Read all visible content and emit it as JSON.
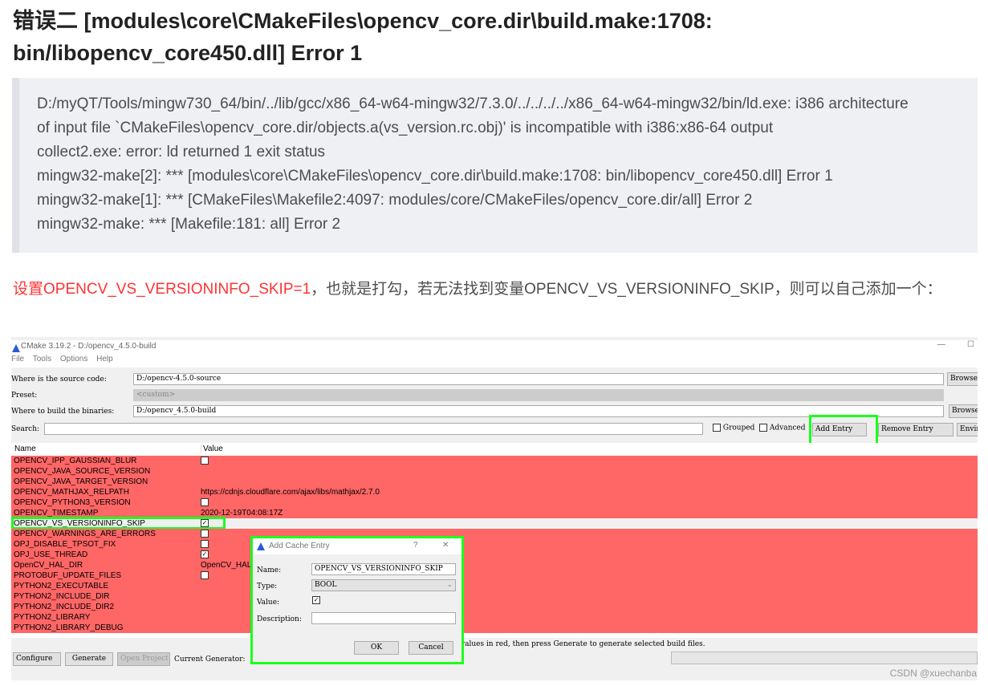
{
  "heading": "错误二 [modules\\core\\CMakeFiles\\opencv_core.dir\\build.make:1708: bin/libopencv_core450.dll] Error 1",
  "quote_lines": [
    "D:/myQT/Tools/mingw730_64/bin/../lib/gcc/x86_64-w64-mingw32/7.3.0/../../../../x86_64-w64-mingw32/bin/ld.exe: i386 architecture",
    "of input file `CMakeFiles\\opencv_core.dir/objects.a(vs_version.rc.obj)' is incompatible with i386:x86-64 output",
    "collect2.exe: error: ld returned 1 exit status",
    "mingw32-make[2]: *** [modules\\core\\CMakeFiles\\opencv_core.dir\\build.make:1708: bin/libopencv_core450.dll] Error 1",
    "mingw32-make[1]: *** [CMakeFiles\\Makefile2:4097: modules/core/CMakeFiles/opencv_core.dir/all] Error 2",
    "mingw32-make: *** [Makefile:181: all] Error 2"
  ],
  "para": {
    "red": "设置OPENCV_VS_VERSIONINFO_SKIP=1",
    "rest": "，也就是打勾，若无法找到变量OPENCV_VS_VERSIONINFO_SKIP，则可以自己添加一个："
  },
  "cmake": {
    "title": "CMake 3.19.2 - D:/opencv_4.5.0-build",
    "menu": [
      "File",
      "Tools",
      "Options",
      "Help"
    ],
    "source_label": "Where is the source code:",
    "source_value": "D:/opencv-4.5.0-source",
    "preset_label": "Preset:",
    "preset_value": "<custom>",
    "build_label": "Where to build the binaries:",
    "build_value": "D:/opencv_4.5.0-build",
    "browse": "Browse",
    "search_label": "Search:",
    "grouped": "Grouped",
    "advanced": "Advanced",
    "add_entry": "Add Entry",
    "remove_entry": "Remove Entry",
    "environment": "Envir",
    "col_name": "Name",
    "col_value": "Value",
    "rows": [
      {
        "name": "OPENCV_IPP_GAUSSIAN_BLUR",
        "value": "",
        "checkbox": false
      },
      {
        "name": "OPENCV_JAVA_SOURCE_VERSION",
        "value": ""
      },
      {
        "name": "OPENCV_JAVA_TARGET_VERSION",
        "value": ""
      },
      {
        "name": "OPENCV_MATHJAX_RELPATH",
        "value": "https://cdnjs.cloudflare.com/ajax/libs/mathjax/2.7.0"
      },
      {
        "name": "OPENCV_PYTHON3_VERSION",
        "value": "",
        "checkbox": false
      },
      {
        "name": "OPENCV_TIMESTAMP",
        "value": "2020-12-19T04:08:17Z"
      },
      {
        "name": "OPENCV_VS_VERSIONINFO_SKIP",
        "value": "",
        "checkbox": true,
        "selected": true
      },
      {
        "name": "OPENCV_WARNINGS_ARE_ERRORS",
        "value": "",
        "checkbox": false
      },
      {
        "name": "OPJ_DISABLE_TPSOT_FIX",
        "value": "",
        "checkbox": false
      },
      {
        "name": "OPJ_USE_THREAD",
        "value": "",
        "checkbox": true
      },
      {
        "name": "OpenCV_HAL_DIR",
        "value": "OpenCV_HAL"
      },
      {
        "name": "PROTOBUF_UPDATE_FILES",
        "value": "",
        "checkbox": false
      },
      {
        "name": "PYTHON2_EXECUTABLE",
        "value": ""
      },
      {
        "name": "PYTHON2_INCLUDE_DIR",
        "value": ""
      },
      {
        "name": "PYTHON2_INCLUDE_DIR2",
        "value": ""
      },
      {
        "name": "PYTHON2_LIBRARY",
        "value": ""
      },
      {
        "name": "PYTHON2_LIBRARY_DEBUG",
        "value": ""
      }
    ],
    "status": "values in red, then press Generate to generate selected build files.",
    "configure": "Configure",
    "generate": "Generate",
    "open_project": "Open Project",
    "current_generator": "Current Generator:",
    "dialog": {
      "title": "Add Cache Entry",
      "help": "?",
      "close": "✕",
      "name_label": "Name:",
      "name_value": "OPENCV_VS_VERSIONINFO_SKIP",
      "type_label": "Type:",
      "type_value": "BOOL",
      "value_label": "Value:",
      "value_checked": true,
      "desc_label": "Description:",
      "desc_value": "",
      "ok": "OK",
      "cancel": "Cancel"
    }
  },
  "watermark": "CSDN @xuechanba",
  "colors": {
    "highlight": "#1cff1c",
    "row_red": "#ff6666",
    "accent_red": "#ff3333"
  }
}
